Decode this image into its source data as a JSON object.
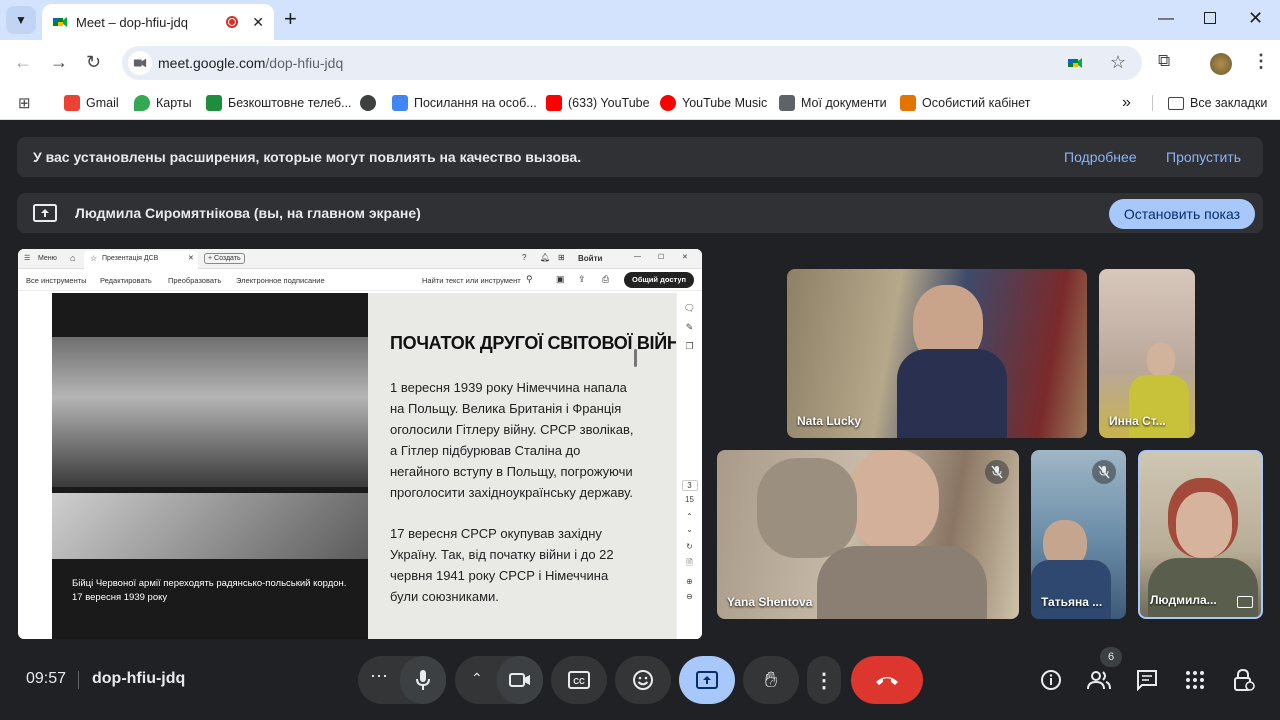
{
  "browser": {
    "tab_title": "Meet – dop-hfiu-jdq",
    "url_host": "meet.google.com",
    "url_path": "/dop-hfiu-jdq",
    "bookmarks": [
      {
        "label": "Gmail",
        "color": "#ea4335"
      },
      {
        "label": "Карты",
        "color": "#34a853"
      },
      {
        "label": "Безкоштовне телеб...",
        "color": "#1e8e3e"
      },
      {
        "label": "",
        "color": "#3c4043"
      },
      {
        "label": "Посилання на особ...",
        "color": "#4285f4"
      },
      {
        "label": "(633) YouTube",
        "color": "#ff0000"
      },
      {
        "label": "YouTube Music",
        "color": "#ff0000"
      },
      {
        "label": "Мої документи",
        "color": "#5f6368"
      },
      {
        "label": "Особистий кабінет",
        "color": "#e37400"
      }
    ],
    "more_label": "»",
    "all_bookmarks": "Все закладки"
  },
  "meet": {
    "extensions_banner": "У вас установлены расширения, которые могут повлиять на качество вызова.",
    "more_link": "Подробнее",
    "skip_link": "Пропустить",
    "presenting_text": "Людмила Сиромятнікова (вы, на главном экране)",
    "stop_button": "Остановить показ",
    "clock": "09:57",
    "meeting_code": "dop-hfiu-jdq",
    "participants_count": "6"
  },
  "presentation": {
    "menu": "Меню",
    "doc_tab": "Презентація ДСВ",
    "create": "+ Создать",
    "login": "Войти",
    "toolbar": [
      "Все инструменты",
      "Редактировать",
      "Преобразовать",
      "Электронное подписание"
    ],
    "find": "Найти текст или инструмент",
    "share": "Общий доступ",
    "slide_title": "ПОЧАТОК ДРУГОЇ СВІТОВОЇ ВІЙНИ",
    "para1": "1 вересня 1939 року Німеччина напала на Польщу. Велика Британія і Франція оголосили Гітлеру війну. СРСР зволікав, а Гітлер підбурював Сталіна до негайного вступу в Польщу, погрожуючи проголосити західноукраїнську державу.",
    "para2": "17 вересня СРСР окупував західну Україну. Так, від початку війни і до 22 червня 1941 року СРСР і Німеччина були союзниками.",
    "caption": "Бійці Червоної армії переходять радянсько-польський кордон. 17 вересня 1939 року",
    "page_current": "3",
    "page_total": "15"
  },
  "participants": [
    {
      "name": "Nata Lucky",
      "muted": false
    },
    {
      "name": "Инна Ст...",
      "muted": false
    },
    {
      "name": "Yana Shentova",
      "muted": true
    },
    {
      "name": "Татьяна ...",
      "muted": true
    },
    {
      "name": "Людмила...",
      "muted": false
    }
  ]
}
